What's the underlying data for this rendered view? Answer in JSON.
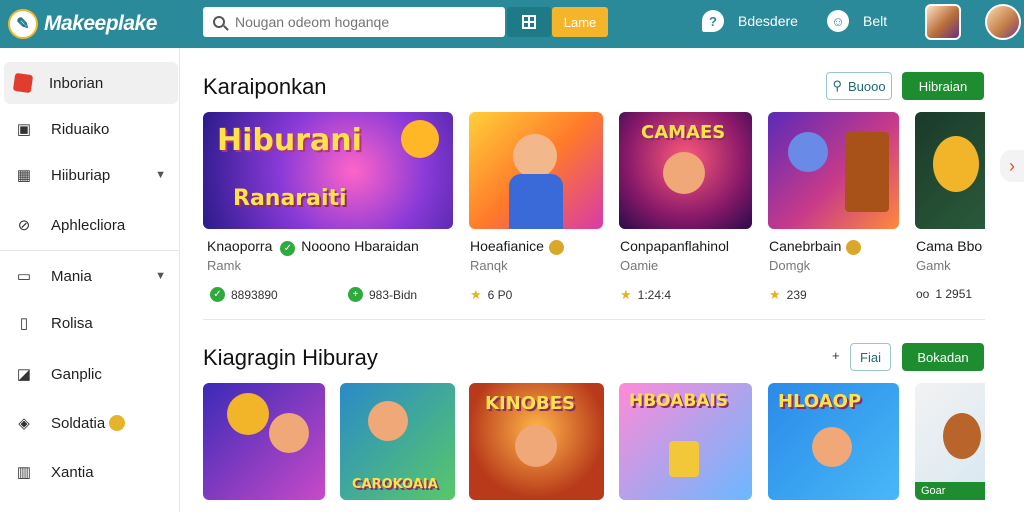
{
  "app": {
    "name": "Makeeplake"
  },
  "search": {
    "placeholder": "Nougan odeom hoganqe"
  },
  "header": {
    "go_label": "Lame",
    "item1": "Bdesdere",
    "item2": "Belt"
  },
  "sidebar": {
    "items": [
      {
        "label": "Inborian",
        "icon": "cube-icon"
      },
      {
        "label": "Riduaiko",
        "icon": "bag-icon"
      },
      {
        "label": "Hiiburiap",
        "icon": "calendar-icon"
      },
      {
        "label": "Aphlecliora",
        "icon": "block-icon"
      },
      {
        "label": "Mania",
        "icon": "screen-icon"
      },
      {
        "label": "Rolisa",
        "icon": "phone-icon"
      },
      {
        "label": "Ganplic",
        "icon": "game-icon"
      },
      {
        "label": "Soldatia",
        "icon": "box-icon"
      },
      {
        "label": "Xantia",
        "icon": "chart-icon"
      }
    ]
  },
  "section1": {
    "title": "Karaiponkan",
    "outline_label": "Buooo",
    "green_label": "Hibraian",
    "cards": [
      {
        "thumb_text": "Hiburani",
        "thumb_sub": "Ranaraiti",
        "title": "Knaoporra",
        "title2": "Nooono Hbaraidan",
        "sub": "Ramk",
        "stat": "8893890",
        "stat2": "983-Bidn"
      },
      {
        "title": "Hoeafianice",
        "sub": "Ranqk",
        "stat": "6 P0"
      },
      {
        "thumb_text": "CAMAES",
        "title": "Conpapanflahinol",
        "sub": "Oamie",
        "stat": "1:24:4"
      },
      {
        "title": "Canebrbain",
        "sub": "Domgk",
        "stat": "239"
      },
      {
        "title": "Cama Bbo",
        "sub": "Gamk",
        "stat": "1 2951"
      }
    ]
  },
  "section2": {
    "title": "Kiagragin Hiburay",
    "plus_label": "+",
    "outline_label": "Fiai",
    "green_label": "Bokadan",
    "cards": [
      {
        "thumb_text": ""
      },
      {
        "thumb_text": "CAROKOAIA"
      },
      {
        "thumb_text": "KINOBES"
      },
      {
        "thumb_text": "HBOABAIS"
      },
      {
        "thumb_text": "HLOAOP"
      },
      {
        "thumb_text": "Goar"
      }
    ]
  },
  "colors": {
    "header": "#2a8a9a",
    "accent_green": "#1e8d2f",
    "accent_yellow": "#f5b52a"
  }
}
